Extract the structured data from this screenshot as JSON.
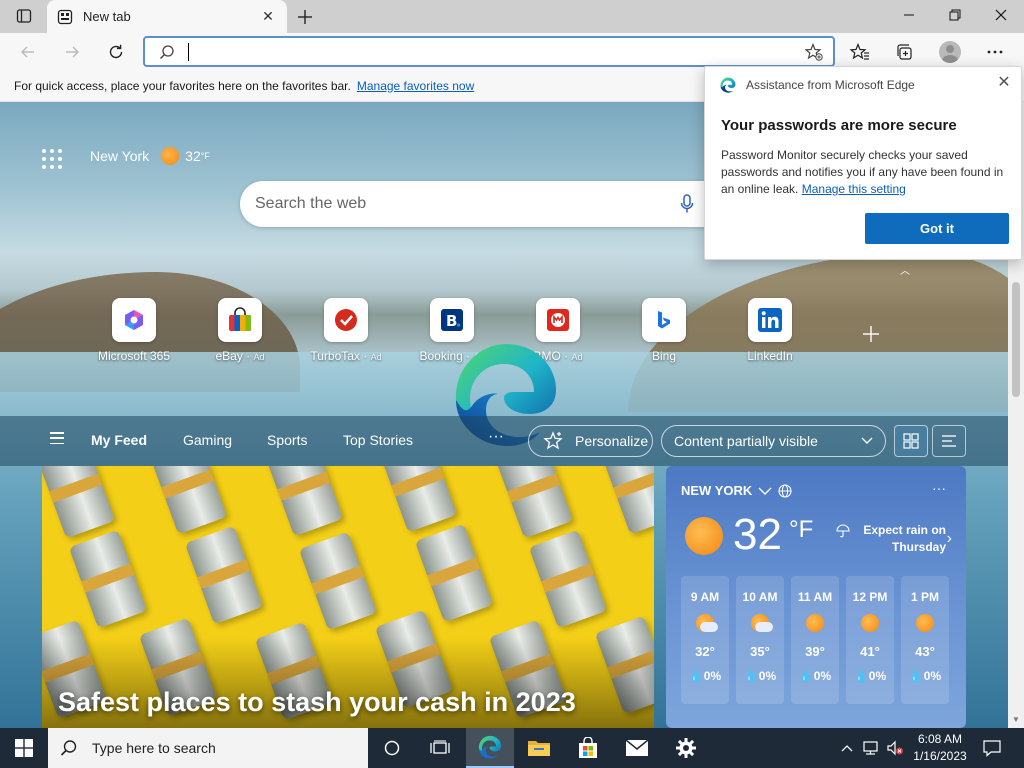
{
  "browser": {
    "tab": {
      "title": "New tab"
    },
    "address": {
      "value": "",
      "placeholder": ""
    },
    "favorites_bar": {
      "message": "For quick access, place your favorites here on the favorites bar.",
      "link": "Manage favorites now"
    }
  },
  "newtab": {
    "weather": {
      "city": "New York",
      "temp": "32",
      "unit": "°F"
    },
    "search": {
      "placeholder": "Search the web"
    },
    "quicklinks": [
      {
        "label": "Microsoft 365",
        "ad": ""
      },
      {
        "label": "eBay",
        "ad": "Ad"
      },
      {
        "label": "TurboTax",
        "ad": "Ad"
      },
      {
        "label": "Booking",
        "ad": "Ad"
      },
      {
        "label": "BMO",
        "ad": "Ad"
      },
      {
        "label": "Bing",
        "ad": ""
      },
      {
        "label": "LinkedIn",
        "ad": ""
      }
    ],
    "feed": {
      "tabs": [
        "My Feed",
        "Gaming",
        "Sports",
        "Top Stories"
      ],
      "more": "···",
      "personalize": "Personalize",
      "content_select": "Content partially visible"
    },
    "hero": {
      "headline": "Safest places to stash your cash in 2023"
    },
    "weather_card": {
      "location": "NEW YORK",
      "temp": "32",
      "unit": "°F",
      "forecast": "Expect rain on Thursday",
      "hours": [
        {
          "time": "9 AM",
          "temp": "32°",
          "precip": "0%",
          "icon": "partly-cloudy-icon"
        },
        {
          "time": "10 AM",
          "temp": "35°",
          "precip": "0%",
          "icon": "partly-cloudy-icon"
        },
        {
          "time": "11 AM",
          "temp": "39°",
          "precip": "0%",
          "icon": "sun-icon"
        },
        {
          "time": "12 PM",
          "temp": "41°",
          "precip": "0%",
          "icon": "sun-icon"
        },
        {
          "time": "1 PM",
          "temp": "43°",
          "precip": "0%",
          "icon": "sun-icon"
        }
      ]
    }
  },
  "popup": {
    "header": "Assistance from Microsoft Edge",
    "title": "Your passwords are more secure",
    "body": "Password Monitor securely checks your saved passwords and notifies you if any have been found in an online leak.",
    "link": "Manage this setting",
    "button": "Got it"
  },
  "taskbar": {
    "search_placeholder": "Type here to search",
    "time": "6:08 AM",
    "date": "1/16/2023"
  },
  "colors": {
    "accent": "#0f6cbd",
    "link": "#0a5ec2",
    "hero_bg": "#f3cf17",
    "taskbar": "#1e2a38"
  }
}
